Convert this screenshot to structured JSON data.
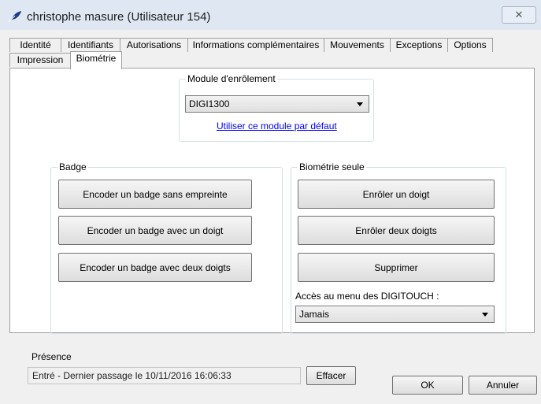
{
  "window": {
    "title": "christophe masure (Utilisateur 154)",
    "close_glyph": "✕"
  },
  "tabs_row1": [
    "Identité",
    "Identifiants",
    "Autorisations",
    "Informations complémentaires",
    "Mouvements",
    "Exceptions",
    "Options"
  ],
  "tabs_row2": [
    "Impression",
    "Biométrie"
  ],
  "active_tab": "Biométrie",
  "module": {
    "label": "Module d'enrôlement",
    "selected": "DIGI1300",
    "default_link": "Utiliser ce module par défaut"
  },
  "badge": {
    "label": "Badge",
    "buttons": [
      "Encoder un badge sans empreinte",
      "Encoder un badge avec un doigt",
      "Encoder un badge avec deux doigts"
    ]
  },
  "biometrie": {
    "label": "Biométrie seule",
    "buttons": [
      "Enrôler un doigt",
      "Enrôler deux doigts",
      "Supprimer"
    ],
    "menu_label": "Accès au menu des DIGITOUCH :",
    "menu_selected": "Jamais"
  },
  "presence": {
    "label": "Présence",
    "status": "Entré - Dernier passage le 10/11/2016 16:06:33",
    "clear_button": "Effacer"
  },
  "footer": {
    "ok": "OK",
    "cancel": "Annuler"
  },
  "colors": {
    "titlebar": "#dfe8f2",
    "link": "#0000ff",
    "icon": "#1f3c8c"
  },
  "icons": {
    "app": "feather-pen-icon",
    "close": "close-icon"
  }
}
